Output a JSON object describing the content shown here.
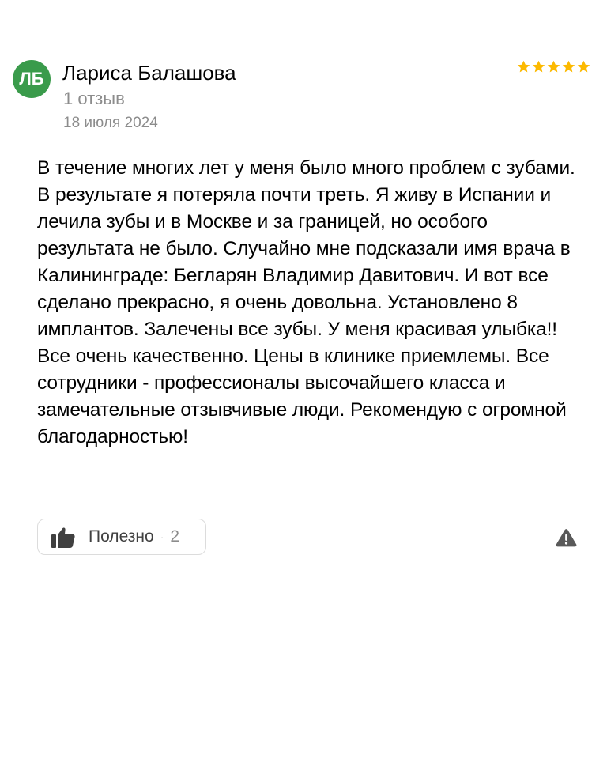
{
  "review": {
    "author": {
      "initials": "ЛБ",
      "name": "Лариса Балашова",
      "reviews_count": "1 отзыв",
      "avatar_color": "#3a9b4b"
    },
    "date": "18 июля 2024",
    "rating": {
      "value": 5,
      "max": 5,
      "star_color": "#fcb900"
    },
    "text": "В течение многих лет у меня было много проблем с зубами. В результате я потеряла почти треть. Я живу в Испании и лечила зубы и в Москве и за границей, но особого результата не было. Случайно мне подсказали имя врача в Калининграде: Бегларян Владимир Давитович. И вот все сделано прекрасно, я очень довольна. Установлено 8 имплантов. Залечены все зубы. У меня красивая улыбка!! Все очень качественно. Цены в клинике приемлемы. Все сотрудники - профессионалы высочайшего класса и замечательные отзывчивые люди. Рекомендую с огромной благодарностью!",
    "actions": {
      "helpful_label": "Полезно",
      "helpful_separator": "·",
      "helpful_count": "2",
      "thumb_icon": "thumbs-up-icon",
      "report_icon": "warning-icon"
    }
  }
}
